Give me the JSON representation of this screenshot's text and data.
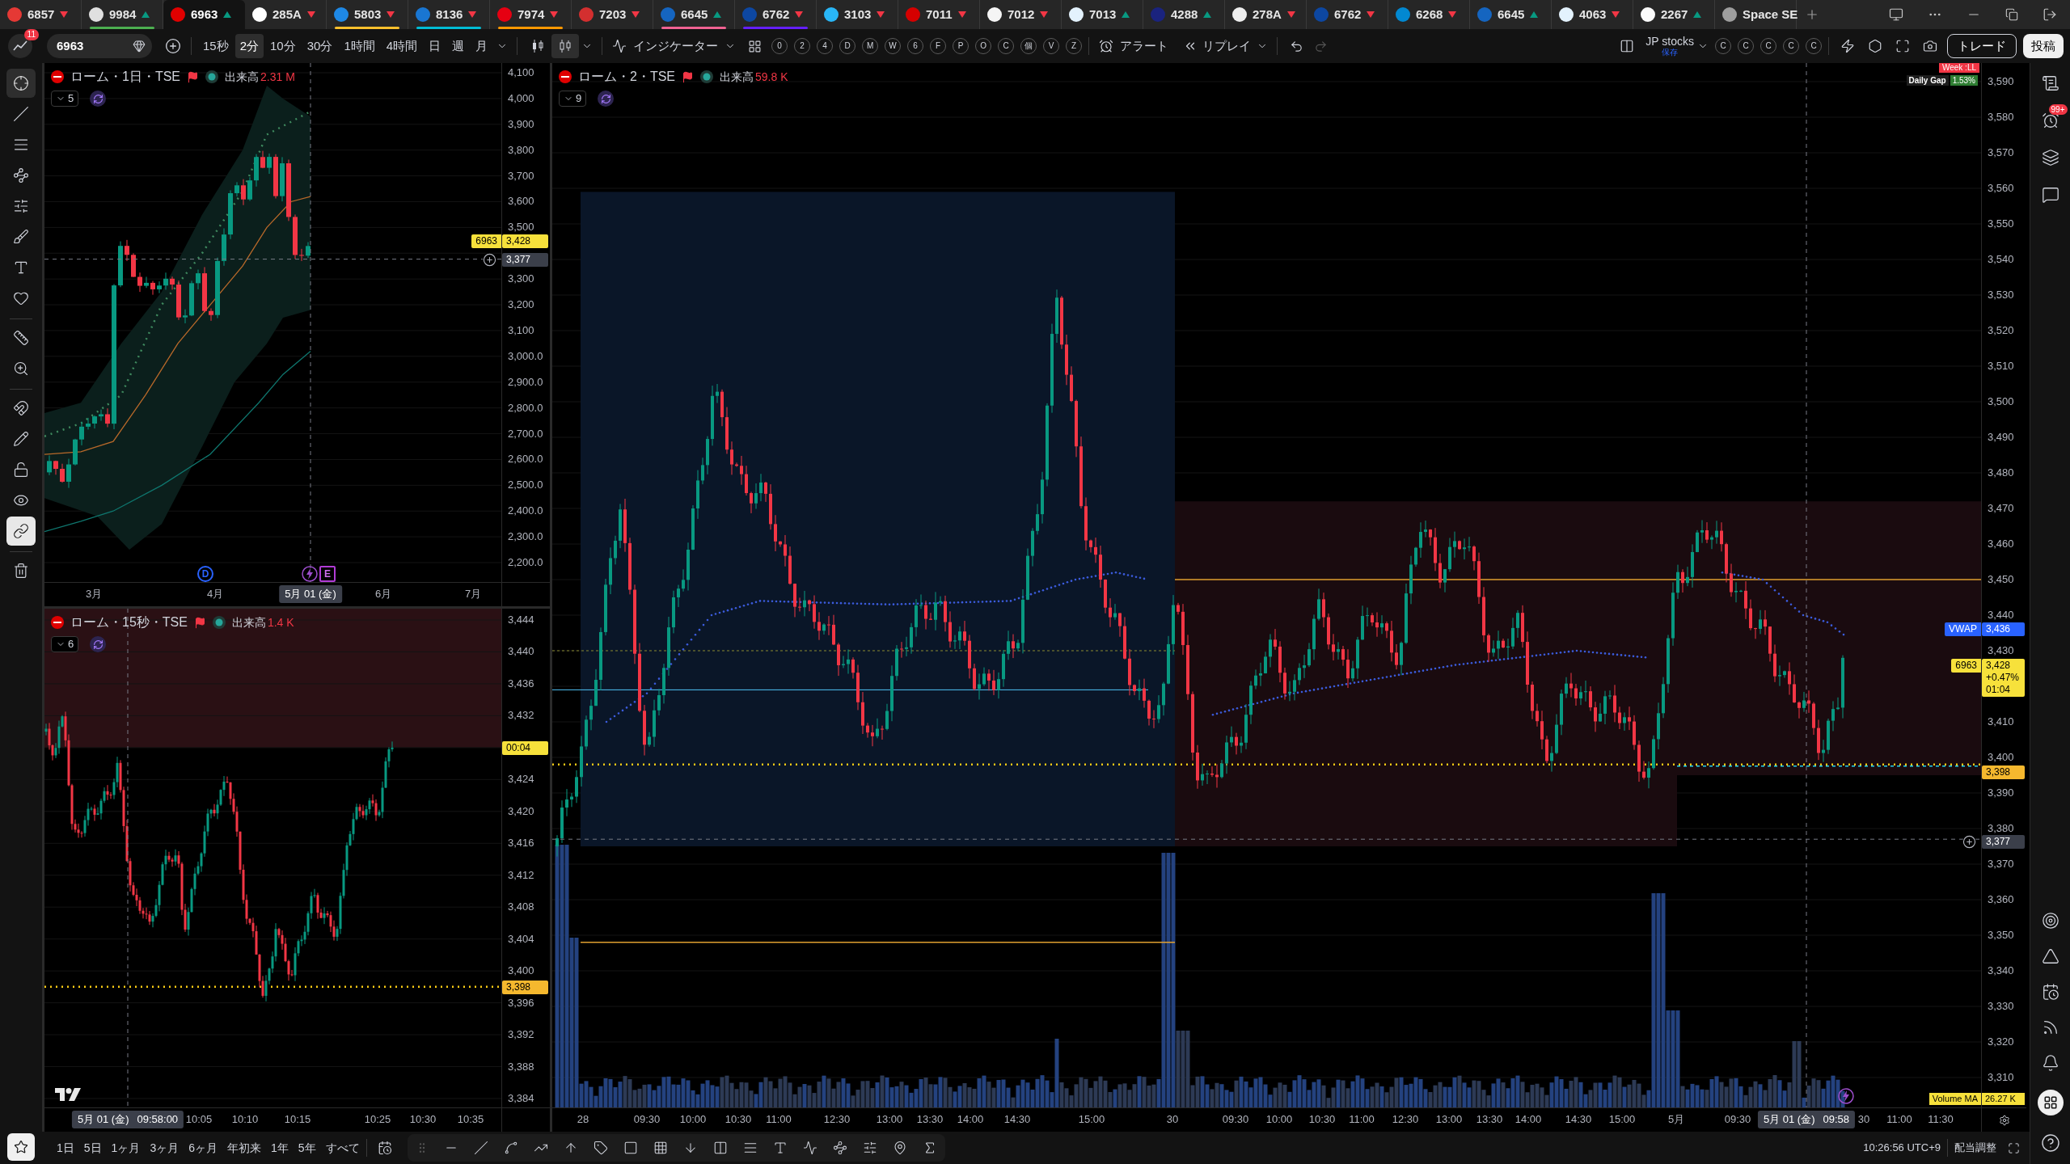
{
  "tabs": [
    {
      "symbol": "6857",
      "kind": "down",
      "selected": false,
      "logo": {
        "color": "#e53935"
      }
    },
    {
      "symbol": "9984",
      "kind": "up",
      "selected": false,
      "logo": {
        "color": "#e0e0e0"
      },
      "underline": {
        "color": "#4caf50"
      }
    },
    {
      "symbol": "6963",
      "kind": "up",
      "selected": true,
      "logo": {
        "color": "#e00000"
      }
    },
    {
      "symbol": "285A",
      "kind": "down",
      "selected": false,
      "logo": {
        "color": "#ffffff"
      }
    },
    {
      "symbol": "5803",
      "kind": "down",
      "selected": false,
      "logo": {
        "color": "#1e88e5"
      },
      "underline": {
        "color": "#fbc02d"
      }
    },
    {
      "symbol": "8136",
      "kind": "down",
      "selected": false,
      "logo": {
        "color": "#1976d2"
      },
      "underline": {
        "color": "#00bcd4"
      }
    },
    {
      "symbol": "7974",
      "kind": "down",
      "selected": false,
      "logo": {
        "color": "#e60012"
      },
      "underline": {
        "color": "#ff9800"
      }
    },
    {
      "symbol": "7203",
      "kind": "down",
      "selected": false,
      "logo": {
        "color": "#d32f2f"
      }
    },
    {
      "symbol": "6645",
      "kind": "up",
      "selected": false,
      "logo": {
        "color": "#1565c0"
      },
      "underline": {
        "color": "#f06292"
      }
    },
    {
      "symbol": "6762",
      "kind": "down",
      "selected": false,
      "logo": {
        "color": "#0d47a1"
      },
      "underline": {
        "color": "#651fff"
      }
    },
    {
      "symbol": "3103",
      "kind": "down",
      "selected": false,
      "logo": {
        "color": "#29b6f6"
      }
    },
    {
      "symbol": "7011",
      "kind": "down",
      "selected": false,
      "logo": {
        "color": "#d50000"
      }
    },
    {
      "symbol": "7012",
      "kind": "down",
      "selected": false,
      "logo": {
        "color": "#f5f5f5"
      }
    },
    {
      "symbol": "7013",
      "kind": "up",
      "selected": false,
      "logo": {
        "color": "#e3f2fd"
      }
    },
    {
      "symbol": "4288",
      "kind": "up",
      "selected": false,
      "logo": {
        "color": "#1a237e"
      }
    },
    {
      "symbol": "278A",
      "kind": "down",
      "selected": false,
      "logo": {
        "color": "#eeeeee"
      }
    },
    {
      "symbol": "6762",
      "kind": "down",
      "selected": false,
      "logo": {
        "color": "#0d47a1"
      }
    },
    {
      "symbol": "6268",
      "kind": "down",
      "selected": false,
      "logo": {
        "color": "#0288d1"
      }
    },
    {
      "symbol": "6645",
      "kind": "up",
      "selected": false,
      "logo": {
        "color": "#1565c0"
      }
    },
    {
      "symbol": "4063",
      "kind": "down",
      "selected": false,
      "logo": {
        "color": "#e3f2fd"
      }
    },
    {
      "symbol": "2267",
      "kind": "up",
      "selected": false,
      "logo": {
        "color": "#fafafa"
      }
    },
    {
      "symbol": "Space SE",
      "kind": "none",
      "selected": false,
      "logo": {
        "color": "#9e9e9e"
      }
    }
  ],
  "toolbar": {
    "avatar_badge": "11",
    "symbol": "6963",
    "intervals": [
      {
        "label": "15秒",
        "selected": false
      },
      {
        "label": "2分",
        "selected": true
      },
      {
        "label": "10分",
        "selected": false
      },
      {
        "label": "30分",
        "selected": false
      },
      {
        "label": "1時間",
        "selected": false
      },
      {
        "label": "4時間",
        "selected": false
      },
      {
        "label": "日",
        "selected": false
      },
      {
        "label": "週",
        "selected": false
      },
      {
        "label": "月",
        "selected": false
      }
    ],
    "chart_styles": [
      {
        "kind": "candles",
        "selected": false
      },
      {
        "kind": "hollow-candles",
        "selected": true
      }
    ],
    "indicators": "インジケーター",
    "quick_buttons": [
      "0",
      "2",
      "4",
      "D",
      "M",
      "W",
      "6",
      "F",
      "P",
      "O",
      "C",
      "個",
      "V",
      "Z"
    ],
    "alert": "アラート",
    "replay": "リプレイ",
    "layout_name": "JP stocks",
    "layout_status": "保存",
    "layout_slots": [
      "C",
      "C",
      "C",
      "C",
      "C"
    ],
    "trade": "トレード",
    "publish": "投稿"
  },
  "left_tools": [
    {
      "kind": "crosshair",
      "selected": true
    },
    {
      "kind": "trend-line",
      "selected": false
    },
    {
      "kind": "fib",
      "selected": false
    },
    {
      "kind": "pattern",
      "selected": false
    },
    {
      "kind": "forecast",
      "selected": false
    },
    {
      "kind": "brush",
      "selected": false
    },
    {
      "kind": "text",
      "selected": false
    },
    {
      "kind": "favorite",
      "selected": false
    },
    {
      "kind": "ruler",
      "selected": false
    },
    {
      "kind": "zoom",
      "selected": false
    },
    {
      "kind": "magnet",
      "selected": false
    },
    {
      "kind": "lock-drawing",
      "selected": false
    },
    {
      "kind": "lock",
      "selected": false
    },
    {
      "kind": "visibility",
      "selected": false
    },
    {
      "kind": "link",
      "selected": true
    },
    {
      "kind": "trash",
      "selected": false
    }
  ],
  "left_top_chart": {
    "title": "ローム・1日・TSE",
    "volume_label": "出来高",
    "volume_value": "2.31 M",
    "indicator_count": "5",
    "price_labels": [
      "4,100",
      "4,000",
      "3,900",
      "3,800",
      "3,700",
      "3,600",
      "3,500",
      "3,300",
      "3,200",
      "3,100",
      "3,000.0",
      "2,900.0",
      "2,800.0",
      "2,700.0",
      "2,600.0",
      "2,500.0",
      "2,400.0",
      "2,300.0",
      "2,200.0"
    ],
    "tags": [
      {
        "kind": "last",
        "label": "6963",
        "lines": [
          "3,428"
        ]
      },
      {
        "kind": "crosshair",
        "lines": [
          "3,377"
        ]
      }
    ],
    "markers": [
      {
        "kind": "dividend",
        "label": "D"
      },
      {
        "kind": "earnings",
        "label": "E"
      }
    ],
    "time_labels": [
      "3月",
      "4月",
      "6月",
      "7月"
    ],
    "crosshair_time": [
      "5月 01 (金)"
    ]
  },
  "left_bottom_chart": {
    "title": "ローム・15秒・TSE",
    "volume_label": "出来高",
    "volume_value": "1.4 K",
    "indicator_count": "6",
    "price_labels": [
      "3,444",
      "3,440",
      "3,436",
      "3,432",
      "3,424",
      "3,420",
      "3,416",
      "3,412",
      "3,408",
      "3,404",
      "3,400",
      "3,396",
      "3,392",
      "3,388",
      "3,384"
    ],
    "tags": [
      {
        "kind": "countdown",
        "lines": [
          "00:04"
        ]
      },
      {
        "kind": "level",
        "lines": [
          "3,398"
        ]
      }
    ],
    "time_labels": [
      "10:05",
      "10:10",
      "10:15",
      "10:25",
      "10:30",
      "10:35"
    ],
    "crosshair_time": [
      "5月 01 (金)",
      "09:58:00"
    ]
  },
  "main_chart": {
    "title": "ローム・2・TSE",
    "volume_label": "出来高",
    "volume_value": "59.8 K",
    "indicator_count": "9",
    "week_tag": "Week :LL",
    "gap_label": "Daily Gap",
    "gap_value": "1.53%",
    "price_labels": [
      "3,590",
      "3,580",
      "3,570",
      "3,560",
      "3,550",
      "3,540",
      "3,530",
      "3,520",
      "3,510",
      "3,500",
      "3,490",
      "3,480",
      "3,470",
      "3,460",
      "3,450",
      "3,440",
      "3,430",
      "3,410",
      "3,400",
      "3,390",
      "3,380",
      "3,370",
      "3,360",
      "3,350",
      "3,340",
      "3,330",
      "3,320",
      "3,310"
    ],
    "tags": [
      {
        "kind": "vwap",
        "label": "VWAP",
        "lines": [
          "3,436"
        ]
      },
      {
        "kind": "last",
        "label": "6963",
        "lines": [
          "3,428",
          "+0.47%",
          "01:04"
        ]
      },
      {
        "kind": "level",
        "lines": [
          "3,398"
        ]
      },
      {
        "kind": "crosshair",
        "lines": [
          "3,377"
        ]
      }
    ],
    "volume_ma_label": "Volume MA",
    "volume_ma_value": "26.27 K",
    "time_labels": [
      "28",
      "09:30",
      "10:00",
      "10:30",
      "11:00",
      "12:30",
      "13:00",
      "13:30",
      "14:00",
      "14:30",
      "15:00",
      "30",
      "09:30",
      "10:00",
      "10:30",
      "11:00",
      "12:30",
      "13:00",
      "13:30",
      "14:00",
      "14:30",
      "15:00",
      "5月",
      "09:30",
      "30",
      "11:00",
      "11:30"
    ],
    "crosshair_time": [
      "5月 01 (金)",
      "09:58"
    ]
  },
  "bottom_bar": {
    "ranges": [
      "1日",
      "5日",
      "1ヶ月",
      "3ヶ月",
      "6ヶ月",
      "年初来",
      "1年",
      "5年",
      "すべて"
    ],
    "clock": "10:26:56 UTC+9",
    "adjustment": "配当調整"
  },
  "right_sidebar": {
    "alerts_badge": "99+"
  }
}
